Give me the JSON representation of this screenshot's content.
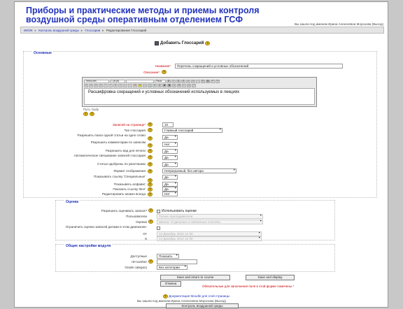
{
  "header": {
    "title_line1": "Приборы и практические методы и приемы контроля",
    "title_line2": "воздушной среды оперативным отделением ГСФ",
    "logged_in": "Вы зашли под именем Ирина Алексеевна Морозова (Выход)"
  },
  "breadcrumb": [
    "ИИОК",
    "Контроль воздушной среды",
    "Глоссарии",
    "Редактирование Глоссарий"
  ],
  "page_heading": "Добавить Глоссарий",
  "sections": {
    "main": "Основные",
    "grading": "Оценка",
    "common": "Общие настройки модуля"
  },
  "main_form": {
    "name_label": "Название*",
    "name_value": "Перечень сокращений и условных обозначений",
    "desc_label": "Описание*",
    "desc_text": "Расшифровка сокращений и условных обозначений используемых в лекциях",
    "toolbar_font": "Trebuchet",
    "toolbar_size": "1 (8 pt)",
    "toolbar_lang": "Язык",
    "editor_path": "Путь: body",
    "entries_label": "Записей на странице*",
    "entries_value": "10",
    "type_label": "Тип глоссария",
    "type_value": "Главный глоссарий",
    "dup_label": "Разрешить поиск одной статьи на одно слово",
    "dup_value": "Да",
    "comments_label": "Разрешить комментарии по записям",
    "comments_value": "Нет",
    "print_label": "Разрешить вид для печати",
    "print_value": "Да",
    "autolink_label": "Автоматическое связывание записей глоссария",
    "autolink_value": "Да",
    "approved_label": "Статьи одобрены по умолчанию",
    "approved_value": "Да",
    "display_label": "Формат отображения",
    "display_value": "Непрерывный, без автора",
    "special_label": "Показывать ссылку 'Специальные'",
    "special_value": "Да",
    "alpha_label": "Показывать алфавит",
    "alpha_value": "Да",
    "all_label": "Показать ссылку 'Все'",
    "all_value": "Да",
    "edit_label": "Редактировать можно всегда",
    "edit_value": "Нет"
  },
  "grading_form": {
    "allow_label": "Разрешить оценивать записи?",
    "allow_checkbox": "Использовать оценки",
    "users_label": "Пользователи",
    "users_value": "Только преподаватели",
    "scale_label": "Оценка",
    "scale_value": "Шкала: Отдельные и связанные способы",
    "restrict_label": "Ограничить оценки записей датами в этом диапазоне:",
    "from_label": "От",
    "to_label": "К",
    "date_value": "14 Декабрь 2010 12 00"
  },
  "common_form": {
    "visible_label": "Доступные",
    "visible_value": "Показать",
    "id_label": "ID-number",
    "id_value": "",
    "grade_label": "Grade category",
    "grade_value": "Без категории"
  },
  "buttons": {
    "save_return": "Save and return to course",
    "save_display": "Save and display",
    "cancel": "Отмена"
  },
  "required_note": "Обязательные для заполнения поля в этой форме помечены *",
  "footer": {
    "docs": "Документация Moodle для этой страницы",
    "logged": "Вы зашли под именем Ирина Алексеевна Морозова (Выход)",
    "course": "Контроль воздушной среды"
  }
}
